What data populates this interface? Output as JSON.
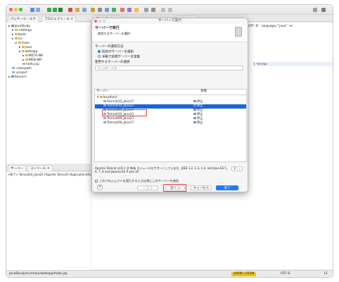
{
  "window": {
    "toolbar_title": "",
    "search_icon": "search-icon"
  },
  "explorer": {
    "tabs": [
      "パッケージ・エク",
      "プロジェクト・エ"
    ],
    "tree": [
      {
        "label": "JavaStudy",
        "indent": 0,
        "kind": "project"
      },
      {
        "label": ".settings",
        "indent": 1,
        "kind": "folder"
      },
      {
        "label": "build",
        "indent": 1,
        "kind": "folder"
      },
      {
        "label": "src",
        "indent": 1,
        "kind": "folder"
      },
      {
        "label": "main",
        "indent": 2,
        "kind": "folder"
      },
      {
        "label": "java",
        "indent": 3,
        "kind": "folder"
      },
      {
        "label": "webapp",
        "indent": 3,
        "kind": "folder"
      },
      {
        "label": "META-INF",
        "indent": 4,
        "kind": "folder"
      },
      {
        "label": "WEB-INF",
        "indent": 4,
        "kind": "folder"
      },
      {
        "label": "hello.jsp",
        "indent": 4,
        "kind": "file"
      },
      {
        "label": ".classpath",
        "indent": 1,
        "kind": "file"
      },
      {
        "label": ".project",
        "indent": 1,
        "kind": "file"
      },
      {
        "label": "Servers",
        "indent": 0,
        "kind": "project"
      }
    ]
  },
  "editor": {
    "tabs": [
      "アウトライン",
      "hello.jsp"
    ],
    "lines": [
      "<%@ page contentType=\"text/html; charset=UTF-8\" language=\"java\" %>",
      "l %></p>"
    ]
  },
  "console": {
    "tabs": [
      "サーバー",
      "コンソール"
    ],
    "text": "<終了> Tomcat10_Java21 [Apache Tomcat] /Applications/Eclipse_"
  },
  "dialog": {
    "title": "サーバーで実行",
    "header_title": "サーバーで実行",
    "header_subtitle": "使用するサーバーの選択",
    "method_label": "サーバーの選択方法",
    "radio_existing": "既存のサーバーを選択",
    "radio_new": "手動で新規サーバーを定義",
    "filter_label": "使用するサーバーの選択",
    "filter_placeholder": "フィルター入力",
    "col_server": "サーバー",
    "col_status": "状態",
    "group": "localhost",
    "servers": [
      {
        "name": "Tomcat10_Java17",
        "status": "停止",
        "selected": false
      },
      {
        "name": "Tomcat10_Java21",
        "status": "停止",
        "selected": true
      },
      {
        "name": "Tomcat09_Java17",
        "status": "停止",
        "selected": false
      },
      {
        "name": "Tomcat10_Java11",
        "status": "停止",
        "selected": false
      },
      {
        "name": "Tomcat09_Java21",
        "status": "停止",
        "selected": false
      },
      {
        "name": "Tomcat09_Java17",
        "status": "停止",
        "selected": false
      }
    ],
    "description": "Apache Tomcat v10.1 は Web モジュールをサポートしています。J2EE 1.2, 1.3, 1.4, and Java EE 5, 6, 7, 8 and Jakarta EE 9 and 10",
    "desc_button": "ﾀﾞ...",
    "always_check": "このプロジェクトを実行するときは常にこのサーバーを使用",
    "help": "?",
    "back": "< 戻る",
    "next": "次へ >",
    "cancel": "キャンセル",
    "finish": "完了"
  },
  "status": {
    "path": "JavaStudy/src/main/webapp/hello.jsp",
    "memory": "490M / 593M",
    "encoding": "UTF-8",
    "line_ending": "LF"
  },
  "colors": {
    "selection": "#1a64d8",
    "primary": "#1e7cf0",
    "highlight": "#e53935"
  }
}
